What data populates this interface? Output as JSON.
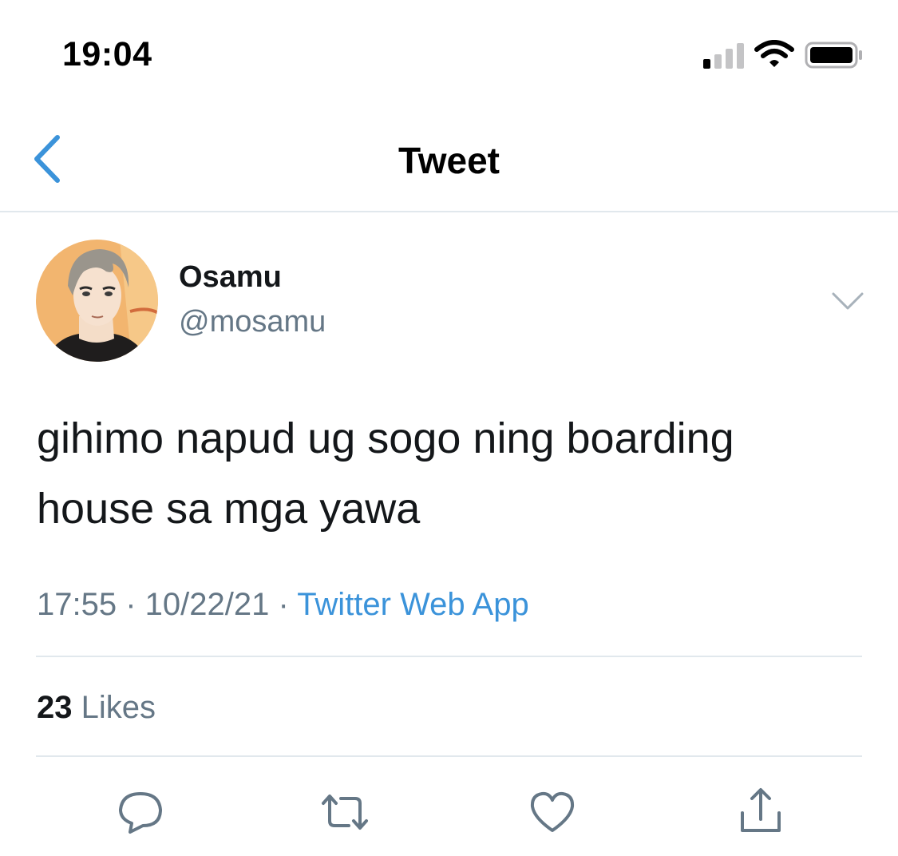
{
  "status_bar": {
    "time": "19:04",
    "icons": [
      "signal-icon",
      "wifi-icon",
      "battery-icon"
    ]
  },
  "nav": {
    "title": "Tweet",
    "back_icon": "chevron-left-icon"
  },
  "tweet": {
    "author_name": "Osamu",
    "author_handle": "@mosamu",
    "text_line1": "gihimo napud ug sogo ning boarding",
    "text_line2": "house sa mga yawa",
    "time": "17:55",
    "separator1": " · ",
    "date": "10/22/21",
    "separator2": " · ",
    "source": "Twitter Web App",
    "likes_count": "23",
    "likes_label": "Likes"
  },
  "actions": [
    "reply-icon",
    "retweet-icon",
    "like-icon",
    "share-icon"
  ],
  "colors": {
    "accent": "#3b93da",
    "secondary_text": "#657786",
    "primary_text": "#14171a",
    "divider": "#e1e8ed"
  }
}
